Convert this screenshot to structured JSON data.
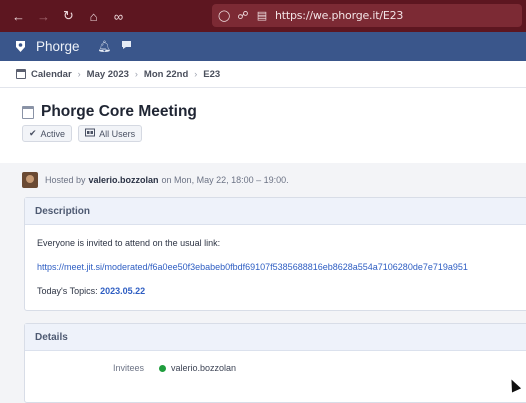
{
  "browser": {
    "url": "https://we.phorge.it/E23",
    "nav_icons": [
      "back-arrow-icon",
      "forward-arrow-icon",
      "reload-icon",
      "home-icon",
      "extensions-icon"
    ]
  },
  "header": {
    "brand": "Phorge"
  },
  "breadcrumbs": {
    "items": [
      "Calendar",
      "May 2023",
      "Mon 22nd",
      "E23"
    ]
  },
  "event": {
    "title": "Phorge Core Meeting",
    "status_tag": "Active",
    "visibility_tag": "All Users",
    "hosted_prefix": "Hosted by",
    "host": "valerio.bozzolan",
    "hosted_suffix": "on Mon, May 22, 18:00 – 19:00."
  },
  "description": {
    "heading": "Description",
    "intro": "Everyone is invited to attend on the usual link:",
    "link": "https://meet.jit.si/moderated/f6a0ee50f3ebabeb0fbdf69107f5385688816eb8628a554a7106280de7e719a951",
    "topics_label": "Today's Topics:",
    "topics_link": "2023.05.22"
  },
  "details": {
    "heading": "Details",
    "invitees_label": "Invitees",
    "invitee": "valerio.bozzolan"
  },
  "colors": {
    "browser_bar": "#5d1620",
    "app_header": "#3a568b",
    "link": "#2e5ec3",
    "status_green": "#1f9d3d"
  }
}
